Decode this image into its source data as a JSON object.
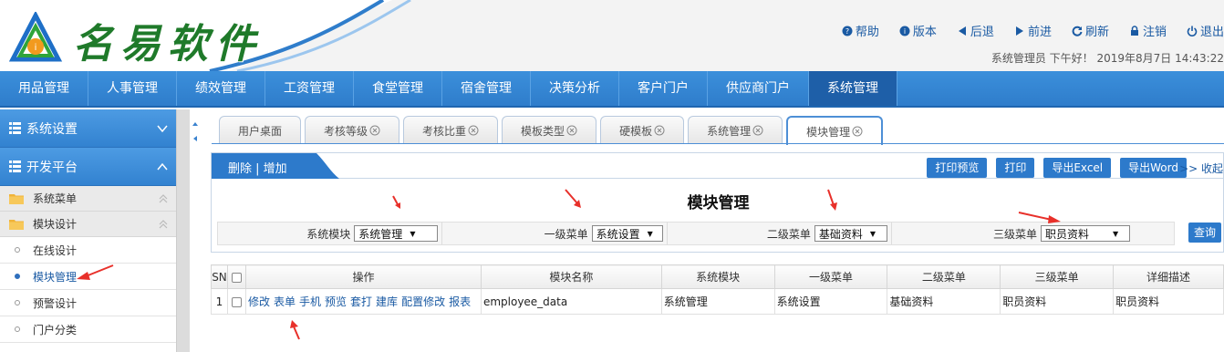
{
  "header": {
    "logo_text": "名易软件",
    "links": [
      {
        "icon": "question-icon",
        "label": "帮助"
      },
      {
        "icon": "info-icon",
        "label": "版本"
      },
      {
        "icon": "back-icon",
        "label": "后退"
      },
      {
        "icon": "forward-icon",
        "label": "前进"
      },
      {
        "icon": "refresh-icon",
        "label": "刷新"
      },
      {
        "icon": "lock-icon",
        "label": "注销"
      },
      {
        "icon": "power-icon",
        "label": "退出"
      }
    ],
    "greeting": "系统管理员 下午好！ 2019年8月7日 14:43:22"
  },
  "nav": {
    "items": [
      "用品管理",
      "人事管理",
      "绩效管理",
      "工资管理",
      "食堂管理",
      "宿舍管理",
      "决策分析",
      "客户门户",
      "供应商门户",
      "系统管理"
    ],
    "active": "系统管理"
  },
  "sidebar": {
    "groups": [
      "系统设置",
      "开发平台"
    ],
    "folders": [
      "系统菜单",
      "模块设计"
    ],
    "leaves": [
      "在线设计",
      "模块管理",
      "预警设计",
      "门户分类"
    ],
    "active_leaf": "模块管理"
  },
  "tabs": [
    {
      "label": "用户桌面",
      "closable": false
    },
    {
      "label": "考核等级",
      "closable": true
    },
    {
      "label": "考核比重",
      "closable": true
    },
    {
      "label": "模板类型",
      "closable": true
    },
    {
      "label": "硬模板",
      "closable": true
    },
    {
      "label": "系统管理",
      "closable": true
    },
    {
      "label": "模块管理",
      "closable": true,
      "active": true
    }
  ],
  "toolbar": {
    "left_text": "删除 | 增加",
    "buttons": [
      "打印预览",
      "打印",
      "导出Excel",
      "导出Word"
    ],
    "collapse": ">> 收起"
  },
  "panel": {
    "title": "模块管理",
    "filters": [
      {
        "label": "系统模块",
        "value": "系统管理"
      },
      {
        "label": "一级菜单",
        "value": "系统设置"
      },
      {
        "label": "二级菜单",
        "value": "基础资料"
      },
      {
        "label": "三级菜单",
        "value": "职员资料"
      }
    ],
    "query_label": "查询"
  },
  "table": {
    "headers": [
      "SN",
      "",
      "操作",
      "模块名称",
      "系统模块",
      "一级菜单",
      "二级菜单",
      "三级菜单",
      "详细描述"
    ],
    "rows": [
      {
        "sn": "1",
        "ops": [
          "修改",
          "表单",
          "手机",
          "预览",
          "套打",
          "建库",
          "配置修改",
          "报表"
        ],
        "name": "employee_data",
        "sys": "系统管理",
        "l1": "系统设置",
        "l2": "基础资料",
        "l3": "职员资料",
        "desc": "职员资料"
      }
    ]
  },
  "colors": {
    "nav_blue": "#2f7dcb",
    "link_blue": "#1a5aa3",
    "logo_green": "#1f7a2a",
    "arrow_red": "#e8302a"
  }
}
